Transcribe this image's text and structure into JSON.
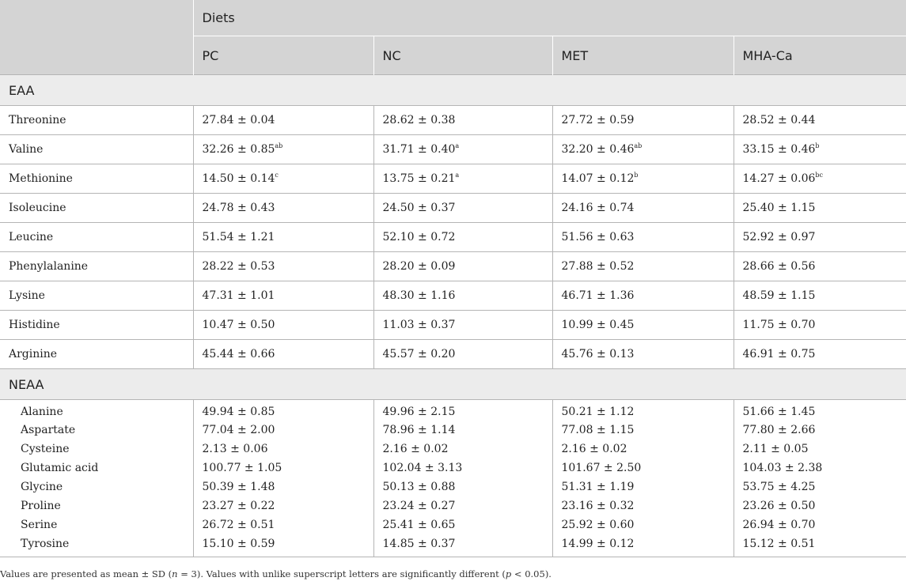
{
  "header": {
    "group_label": "Diets",
    "columns": [
      "PC",
      "NC",
      "MET",
      "MHA-Ca"
    ]
  },
  "sections": [
    {
      "label": "EAA",
      "rows": [
        {
          "name": "Threonine",
          "cells": [
            {
              "v": "27.84 ± 0.04",
              "s": ""
            },
            {
              "v": "28.62 ± 0.38",
              "s": ""
            },
            {
              "v": "27.72 ± 0.59",
              "s": ""
            },
            {
              "v": "28.52 ± 0.44",
              "s": ""
            }
          ]
        },
        {
          "name": "Valine",
          "cells": [
            {
              "v": "32.26 ± 0.85",
              "s": "ab"
            },
            {
              "v": "31.71 ± 0.40",
              "s": "a"
            },
            {
              "v": "32.20 ± 0.46",
              "s": "ab"
            },
            {
              "v": "33.15 ± 0.46",
              "s": "b"
            }
          ]
        },
        {
          "name": "Methionine",
          "cells": [
            {
              "v": "14.50 ± 0.14",
              "s": "c"
            },
            {
              "v": "13.75 ± 0.21",
              "s": "a"
            },
            {
              "v": "14.07 ± 0.12",
              "s": "b"
            },
            {
              "v": "14.27 ± 0.06",
              "s": "bc"
            }
          ]
        },
        {
          "name": "Isoleucine",
          "cells": [
            {
              "v": "24.78 ± 0.43",
              "s": ""
            },
            {
              "v": "24.50 ± 0.37",
              "s": ""
            },
            {
              "v": "24.16 ± 0.74",
              "s": ""
            },
            {
              "v": "25.40 ± 1.15",
              "s": ""
            }
          ]
        },
        {
          "name": "Leucine",
          "cells": [
            {
              "v": "51.54 ± 1.21",
              "s": ""
            },
            {
              "v": "52.10 ± 0.72",
              "s": ""
            },
            {
              "v": "51.56 ± 0.63",
              "s": ""
            },
            {
              "v": "52.92 ± 0.97",
              "s": ""
            }
          ]
        },
        {
          "name": "Phenylalanine",
          "cells": [
            {
              "v": "28.22 ± 0.53",
              "s": ""
            },
            {
              "v": "28.20 ± 0.09",
              "s": ""
            },
            {
              "v": "27.88 ± 0.52",
              "s": ""
            },
            {
              "v": "28.66 ± 0.56",
              "s": ""
            }
          ]
        },
        {
          "name": "Lysine",
          "cells": [
            {
              "v": "47.31 ± 1.01",
              "s": ""
            },
            {
              "v": "48.30 ± 1.16",
              "s": ""
            },
            {
              "v": "46.71 ± 1.36",
              "s": ""
            },
            {
              "v": "48.59 ± 1.15",
              "s": ""
            }
          ]
        },
        {
          "name": "Histidine",
          "cells": [
            {
              "v": "10.47 ± 0.50",
              "s": ""
            },
            {
              "v": "11.03 ± 0.37",
              "s": ""
            },
            {
              "v": "10.99 ± 0.45",
              "s": ""
            },
            {
              "v": "11.75 ± 0.70",
              "s": ""
            }
          ]
        },
        {
          "name": "Arginine",
          "cells": [
            {
              "v": "45.44 ± 0.66",
              "s": ""
            },
            {
              "v": "45.57 ± 0.20",
              "s": ""
            },
            {
              "v": "45.76 ± 0.13",
              "s": ""
            },
            {
              "v": "46.91 ± 0.75",
              "s": ""
            }
          ]
        }
      ]
    },
    {
      "label": "NEAA",
      "rows": [
        {
          "name": "Alanine",
          "cells": [
            {
              "v": "49.94 ± 0.85",
              "s": ""
            },
            {
              "v": "49.96 ± 2.15",
              "s": ""
            },
            {
              "v": "50.21 ± 1.12",
              "s": ""
            },
            {
              "v": "51.66 ± 1.45",
              "s": ""
            }
          ]
        },
        {
          "name": "Aspartate",
          "cells": [
            {
              "v": "77.04 ± 2.00",
              "s": ""
            },
            {
              "v": "78.96 ± 1.14",
              "s": ""
            },
            {
              "v": "77.08 ± 1.15",
              "s": ""
            },
            {
              "v": "77.80 ± 2.66",
              "s": ""
            }
          ]
        },
        {
          "name": "Cysteine",
          "cells": [
            {
              "v": "2.13 ± 0.06",
              "s": ""
            },
            {
              "v": "2.16 ± 0.02",
              "s": ""
            },
            {
              "v": "2.16 ± 0.02",
              "s": ""
            },
            {
              "v": "2.11 ± 0.05",
              "s": ""
            }
          ]
        },
        {
          "name": "Glutamic acid",
          "cells": [
            {
              "v": "100.77 ± 1.05",
              "s": ""
            },
            {
              "v": "102.04 ± 3.13",
              "s": ""
            },
            {
              "v": "101.67 ± 2.50",
              "s": ""
            },
            {
              "v": "104.03 ± 2.38",
              "s": ""
            }
          ]
        },
        {
          "name": "Glycine",
          "cells": [
            {
              "v": "50.39 ± 1.48",
              "s": ""
            },
            {
              "v": "50.13 ± 0.88",
              "s": ""
            },
            {
              "v": "51.31 ± 1.19",
              "s": ""
            },
            {
              "v": "53.75 ± 4.25",
              "s": ""
            }
          ]
        },
        {
          "name": "Proline",
          "cells": [
            {
              "v": "23.27 ± 0.22",
              "s": ""
            },
            {
              "v": "23.24 ± 0.27",
              "s": ""
            },
            {
              "v": "23.16 ± 0.32",
              "s": ""
            },
            {
              "v": "23.26 ± 0.50",
              "s": ""
            }
          ]
        },
        {
          "name": "Serine",
          "cells": [
            {
              "v": "26.72 ± 0.51",
              "s": ""
            },
            {
              "v": "25.41 ± 0.65",
              "s": ""
            },
            {
              "v": "25.92 ± 0.60",
              "s": ""
            },
            {
              "v": "26.94 ± 0.70",
              "s": ""
            }
          ]
        },
        {
          "name": "Tyrosine",
          "cells": [
            {
              "v": "15.10 ± 0.59",
              "s": ""
            },
            {
              "v": "14.85 ± 0.37",
              "s": ""
            },
            {
              "v": "14.99 ± 0.12",
              "s": ""
            },
            {
              "v": "15.12 ± 0.51",
              "s": ""
            }
          ]
        }
      ]
    }
  ],
  "footnote": {
    "part1": "Values are presented as mean ± SD (",
    "n_symbol": "n",
    "part2": " = 3). Values with unlike superscript letters are significantly different (",
    "p_symbol": "p",
    "part3": " < 0.05)."
  }
}
